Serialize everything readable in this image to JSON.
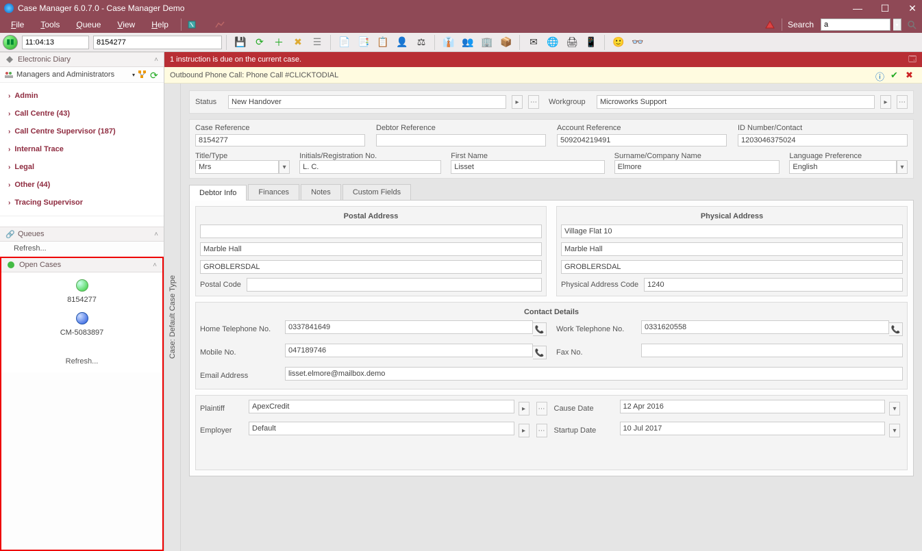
{
  "window": {
    "title": "Case Manager 6.0.7.0 - Case Manager Demo"
  },
  "menu": {
    "file": "File",
    "tools": "Tools",
    "queue": "Queue",
    "view": "View",
    "help": "Help",
    "search_label": "Search",
    "search_value": "a"
  },
  "toolbar": {
    "time": "11:04:13",
    "case_id": "8154277"
  },
  "sidebar": {
    "ediary": "Electronic Diary",
    "filter": "Managers and Administrators",
    "nav": [
      "Admin",
      "Call Centre (43)",
      "Call Centre Supervisor (187)",
      "Internal Trace",
      "Legal",
      "Other (44)",
      "Tracing Supervisor"
    ],
    "queues": "Queues",
    "queues_refresh": "Refresh...",
    "open_cases": "Open Cases",
    "open_case_1": "8154277",
    "open_case_2": "CM-5083897",
    "open_refresh": "Refresh..."
  },
  "alert": "1 instruction is due on the current case.",
  "callbar": "Outbound Phone Call: Phone Call #CLICKTODIAL",
  "vtab": "Case: Default Case Type",
  "case": {
    "status_lbl": "Status",
    "status_val": "New Handover",
    "workgroup_lbl": "Workgroup",
    "workgroup_val": "Microworks Support",
    "caseref_lbl": "Case Reference",
    "caseref_val": "8154277",
    "debtorref_lbl": "Debtor Reference",
    "debtorref_val": "",
    "acctref_lbl": "Account Reference",
    "acctref_val": "509204219491",
    "idnum_lbl": "ID Number/Contact",
    "idnum_val": "1203046375024",
    "title_lbl": "Title/Type",
    "title_val": "Mrs",
    "initials_lbl": "Initials/Registration No.",
    "initials_val": "L. C.",
    "firstname_lbl": "First Name",
    "firstname_val": "Lisset",
    "surname_lbl": "Surname/Company Name",
    "surname_val": "Elmore",
    "lang_lbl": "Language Preference",
    "lang_val": "English"
  },
  "tabs": {
    "debtor": "Debtor Info",
    "finances": "Finances",
    "notes": "Notes",
    "custom": "Custom Fields"
  },
  "postal": {
    "hdr": "Postal Address",
    "l1": "",
    "l2": "Marble Hall",
    "l3": "GROBLERSDAL",
    "pc_lbl": "Postal Code",
    "pc_val": ""
  },
  "physical": {
    "hdr": "Physical Address",
    "l1": "Village Flat 10",
    "l2": "Marble Hall",
    "l3": "GROBLERSDAL",
    "pc_lbl": "Physical Address Code",
    "pc_val": "1240"
  },
  "contact": {
    "hdr": "Contact Details",
    "home_lbl": "Home Telephone No.",
    "home_val": "0337841649",
    "work_lbl": "Work Telephone No.",
    "work_val": "0331620558",
    "mobile_lbl": "Mobile No.",
    "mobile_val": "047189746",
    "fax_lbl": "Fax No.",
    "fax_val": "",
    "email_lbl": "Email Address",
    "email_val": "lisset.elmore@mailbox.demo"
  },
  "footer": {
    "plaintiff_lbl": "Plaintiff",
    "plaintiff_val": "ApexCredit",
    "causedate_lbl": "Cause Date",
    "causedate_val": "12 Apr 2016",
    "employer_lbl": "Employer",
    "employer_val": "Default",
    "startup_lbl": "Startup Date",
    "startup_val": "10 Jul 2017"
  }
}
